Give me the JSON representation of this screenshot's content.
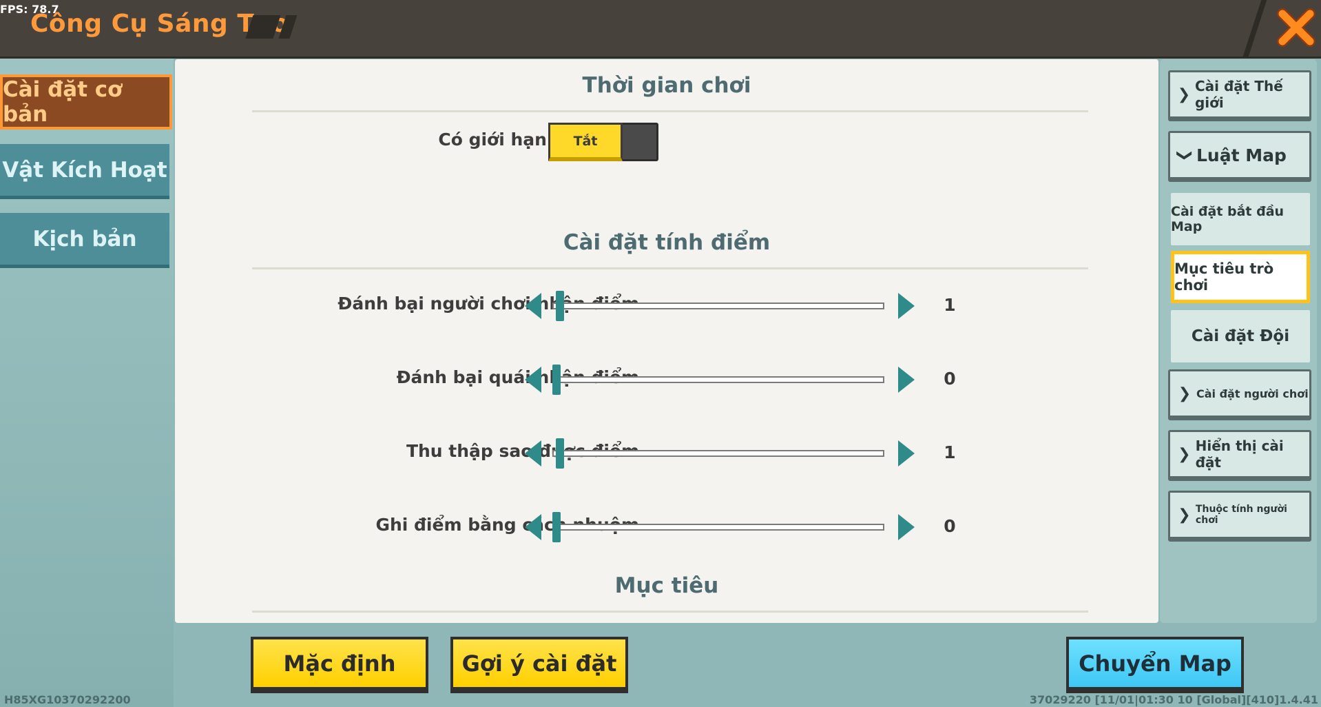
{
  "header": {
    "fps": "FPS: 78.7",
    "title": "Công Cụ Sáng Tạo"
  },
  "left_tabs": [
    {
      "label": "Cài đặt cơ bản",
      "active": true
    },
    {
      "label": "Vật Kích Hoạt",
      "active": false
    },
    {
      "label": "Kịch bản",
      "active": false
    }
  ],
  "main": {
    "section_time": "Thời gian chơi",
    "time_limit_label": "Có giới hạn thời gian",
    "time_limit_toggle": "Tắt",
    "section_score": "Cài đặt tính điểm",
    "sliders": [
      {
        "label": "Đánh bại người chơi nhận điểm",
        "value": "1"
      },
      {
        "label": "Đánh bại quái nhận điểm",
        "value": "0"
      },
      {
        "label": "Thu thập sao được điểm",
        "value": "1"
      },
      {
        "label": "Ghi điểm bằng cách nhuộm",
        "value": "0"
      }
    ],
    "section_goal": "Mục tiêu"
  },
  "right_panel": {
    "world_settings": "Cài đặt Thế giới",
    "map_rules": "Luật Map",
    "map_start": "Cài đặt bắt đầu Map",
    "game_goal": "Mục tiêu trò chơi",
    "team_settings": "Cài đặt Đội",
    "player_settings": "Cài đặt người chơi",
    "display_settings": "Hiển thị cài đặt",
    "player_attributes": "Thuộc tính người chơi"
  },
  "buttons": {
    "default": "Mặc định",
    "suggest": "Gợi ý cài đặt",
    "switch_map": "Chuyển Map"
  },
  "footer": {
    "left": "H85XG10370292200",
    "right": "37029220   [11/01|01:30 10  [Global][410]1.4.41"
  },
  "colors": {
    "accent_orange": "#ff9a3c",
    "toggle_yellow": "#ffd92a",
    "slider_teal": "#2f8a8a",
    "button_blue": "#3ec7f5"
  }
}
